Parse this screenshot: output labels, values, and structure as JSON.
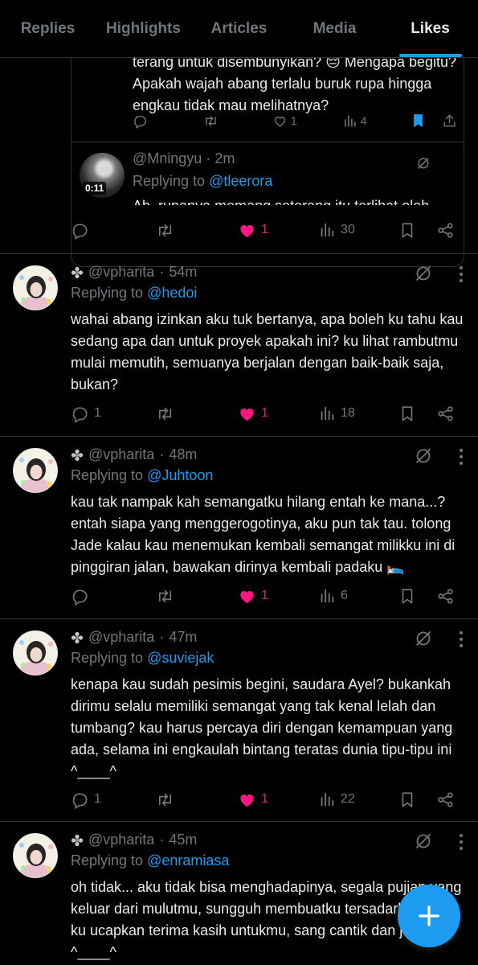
{
  "tabs": [
    {
      "label": "Replies",
      "active": false
    },
    {
      "label": "Highlights",
      "active": false
    },
    {
      "label": "Articles",
      "active": false
    },
    {
      "label": "Media",
      "active": false
    },
    {
      "label": "Likes",
      "active": true
    }
  ],
  "accent_color": "#1d9bf0",
  "like_color": "#f91880",
  "top": {
    "quote": {
      "text": "terang untuk disembunyikan? 😔 Mengapa begitu? Apakah wajah abang terlalu buruk rupa hingga engkau tidak mau melihatnya?",
      "reply_count": "",
      "repost_count": "",
      "like_count": "1",
      "view_count": "4"
    },
    "inner_reply": {
      "handle": "@Mningyu",
      "time": "2m",
      "replying_prefix": "Replying to ",
      "replying_to": "@tleerora",
      "video_duration": "0:11",
      "cut_text": "Ah, rupanya memang seterang itu terlihat oleh"
    },
    "actions": {
      "reply": "",
      "repost": "",
      "like": "1",
      "views": "30"
    }
  },
  "tweets": [
    {
      "handle": "@vpharita",
      "time": "54m",
      "replying_prefix": "Replying to ",
      "replying_to": "@hedoi",
      "text": "wahai abang izinkan aku tuk bertanya, apa boleh ku tahu kau sedang apa dan untuk proyek apakah ini? ku lihat rambutmu mulai memutih, semuanya berjalan dengan baik-baik saja, bukan?",
      "reply": "1",
      "repost": "",
      "like": "1",
      "views": "18"
    },
    {
      "handle": "@vpharita",
      "time": "48m",
      "replying_prefix": "Replying to ",
      "replying_to": "@Juhtoon",
      "text": "kau tak nampak kah semangatku hilang entah ke mana...? entah siapa yang menggerogotinya, aku pun tak tau. tolong Jade kalau kau menemukan kembali semangat milikku ini di pinggiran jalan, bawakan dirinya kembali padaku 🛌",
      "reply": "",
      "repost": "",
      "like": "1",
      "views": "6"
    },
    {
      "handle": "@vpharita",
      "time": "47m",
      "replying_prefix": "Replying to ",
      "replying_to": "@suviejak",
      "text": "kenapa kau sudah pesimis begini, saudara Ayel? bukankah dirimu selalu memiliki semangat yang tak kenal lelah dan tumbang? kau harus percaya diri dengan kemampuan yang ada, selama ini engkaulah bintang teratas dunia tipu-tipu ini ^____^",
      "reply": "1",
      "repost": "",
      "like": "1",
      "views": "22"
    },
    {
      "handle": "@vpharita",
      "time": "45m",
      "replying_prefix": "Replying to ",
      "replying_to": "@enramiasa",
      "text": "oh tidak... aku tidak bisa menghadapinya, segala pujian yang keluar dari mulutmu, sungguh membuatku tersadarkan diri. ku ucapkan terima kasih untukmu, sang cantik dan jelita ^____^",
      "reply": "",
      "repost": "",
      "like": "",
      "views": ""
    }
  ],
  "icons": {
    "reply": "reply-bubble-icon",
    "repost": "repost-icon",
    "like": "heart-icon",
    "views": "views-bar-icon",
    "bookmark": "bookmark-icon",
    "share": "share-icon",
    "grok": "grok-icon",
    "more": "more-vertical-icon",
    "compose": "plus-icon"
  }
}
